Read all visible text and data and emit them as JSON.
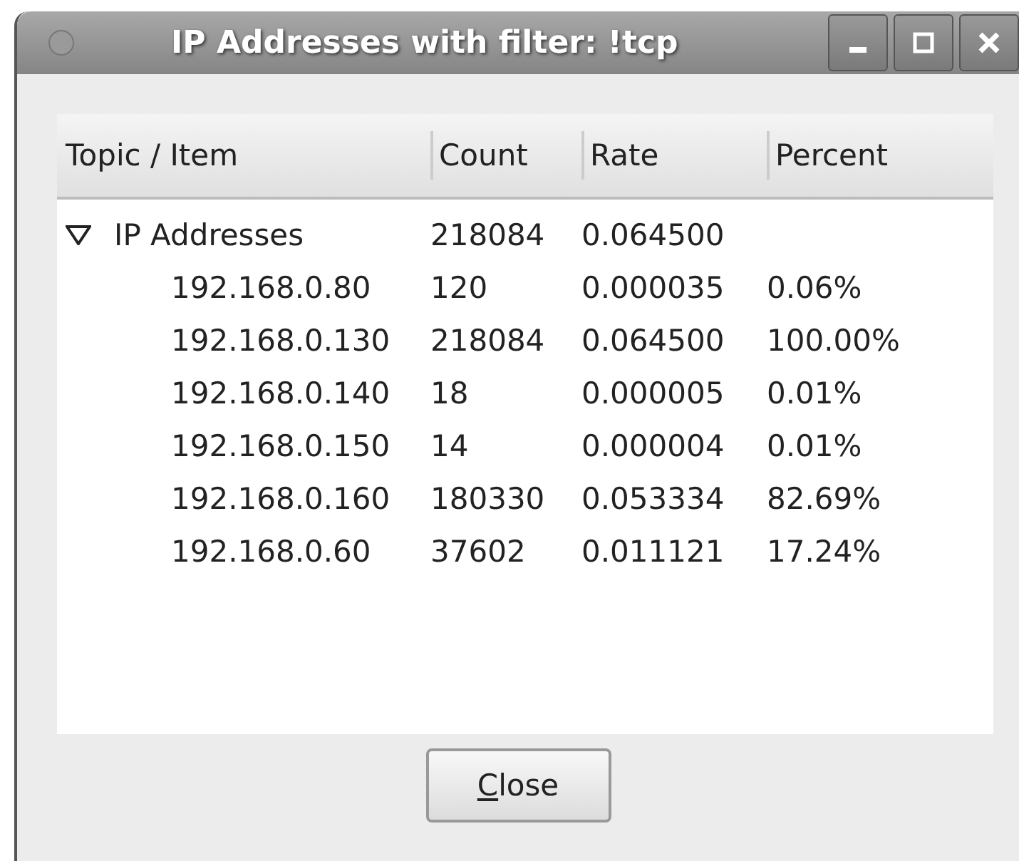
{
  "window": {
    "title": "IP Addresses with filter: !tcp"
  },
  "table": {
    "columns": [
      "Topic / Item",
      "Count",
      "Rate",
      "Percent"
    ],
    "rows": [
      {
        "topic": "IP Addresses",
        "count": "218084",
        "rate": "0.064500",
        "expanded": true,
        "children": [
          {
            "topic": "192.168.0.80",
            "count": "120",
            "rate": "0.000035",
            "percent": "0.06%"
          },
          {
            "topic": "192.168.0.130",
            "count": "218084",
            "rate": "0.064500",
            "percent": "100.00%"
          },
          {
            "topic": "192.168.0.140",
            "count": "18",
            "rate": "0.000005",
            "percent": "0.01%"
          },
          {
            "topic": "192.168.0.150",
            "count": "14",
            "rate": "0.000004",
            "percent": "0.01%"
          },
          {
            "topic": "192.168.0.160",
            "count": "180330",
            "rate": "0.053334",
            "percent": "82.69%"
          },
          {
            "topic": "192.168.0.60",
            "count": "37602",
            "rate": "0.011121",
            "percent": "17.24%"
          }
        ]
      }
    ]
  },
  "close_button": {
    "label": "Close",
    "mnemonic_underlined": true
  }
}
